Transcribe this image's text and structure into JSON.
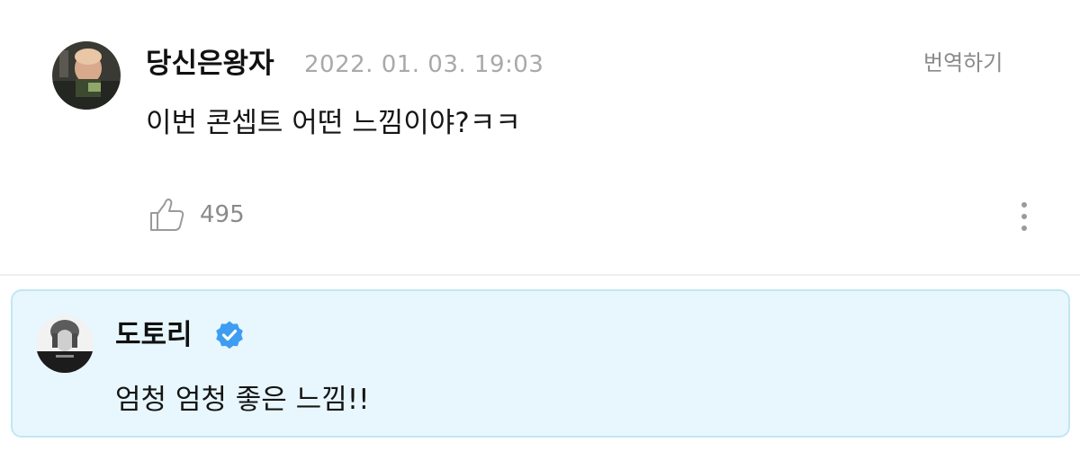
{
  "comment": {
    "username": "당신은왕자",
    "timestamp": "2022. 01. 03. 19:03",
    "translate_label": "번역하기",
    "text": "이번 콘셉트 어떤 느낌이야?ㅋㅋ",
    "like_count": "495",
    "icons": {
      "like": "thumbs-up-icon",
      "more": "more-vertical-icon"
    }
  },
  "reply": {
    "username": "도토리",
    "text": "엄청 엄청 좋은 느낌!!",
    "icons": {
      "verified": "verified-badge-icon"
    }
  },
  "colors": {
    "reply_background": "#e8f7fd",
    "reply_border": "#c2e6f3",
    "verified_badge": "#3d9df2",
    "muted_text": "#a9a9a9"
  }
}
